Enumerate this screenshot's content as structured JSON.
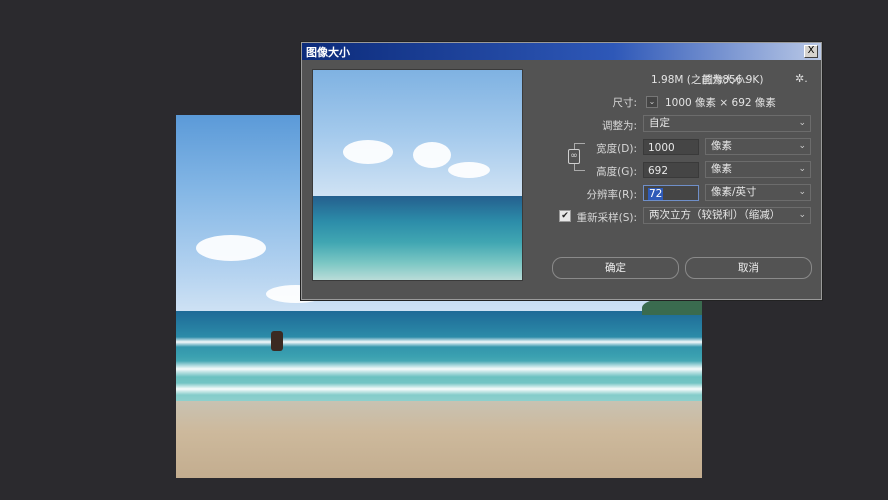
{
  "dialog": {
    "title": "图像大小",
    "close_glyph": "X",
    "image_size_label": "图像大小:",
    "image_size_value": "1.98M (之前为856.9K)",
    "dimensions_label": "尺寸:",
    "dimensions_value": "1000 像素 × 692 像素",
    "fit_to_label": "调整为:",
    "fit_to_value": "自定",
    "width_label": "宽度(D):",
    "width_value": "1000",
    "width_unit": "像素",
    "height_label": "高度(G):",
    "height_value": "692",
    "height_unit": "像素",
    "resolution_label": "分辨率(R):",
    "resolution_value": "72",
    "resolution_unit": "像素/英寸",
    "resample_label": "重新采样(S):",
    "resample_checked": true,
    "resample_value": "两次立方（较锐利）（缩减）",
    "ok_label": "确定",
    "cancel_label": "取消",
    "gear_glyph": "✲.",
    "chevron_glyph": "⌄",
    "check_glyph": "✔"
  }
}
